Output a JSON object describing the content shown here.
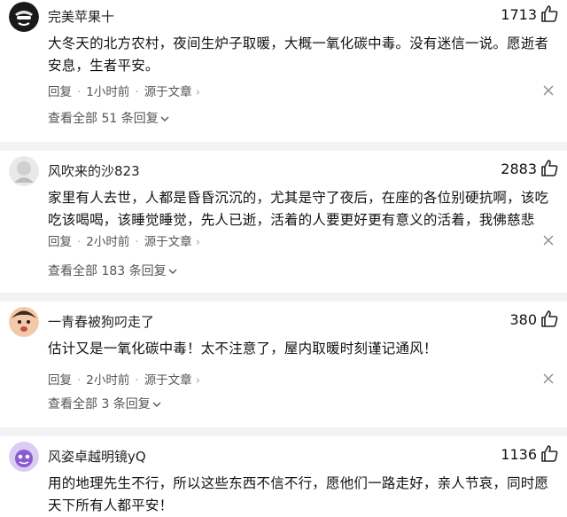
{
  "comments": [
    {
      "username": "完美苹果十",
      "likes": "1713",
      "text": "大冬天的北方农村，夜间生炉子取暖，大概一氧化碳中毒。没有迷信一说。愿逝者安息，生者平安。",
      "reply_label": "回复",
      "time": "1小时前",
      "source": "源于文章",
      "replies_label": "查看全部 51 条回复"
    },
    {
      "username": "风吹来的沙823",
      "likes": "2883",
      "text": "家里有人去世，人都是昏昏沉沉的，尤其是守了夜后，在座的各位别硬抗啊，该吃吃该喝喝，该睡觉睡觉，先人已逝，活着的人要更好更有意义的活着，我佛慈悲",
      "reply_label": "回复",
      "time": "2小时前",
      "source": "源于文章",
      "replies_label": "查看全部 183 条回复"
    },
    {
      "username": "一青春被狗叼走了",
      "likes": "380",
      "text": "估计又是一氧化碳中毒！太不注意了，屋内取暖时刻谨记通风！",
      "reply_label": "回复",
      "time": "2小时前",
      "source": "源于文章",
      "replies_label": "查看全部 3 条回复"
    },
    {
      "username": "风姿卓越明镜yQ",
      "likes": "1136",
      "text": "用的地理先生不行，所以这些东西不信不行，愿他们一路走好，亲人节哀，同时愿天下所有人都平安！"
    }
  ],
  "icons": {
    "like": "thumbs-up-icon",
    "dismiss": "close-icon",
    "expand": "chevron-down-icon",
    "more": "chevron-right-icon"
  }
}
